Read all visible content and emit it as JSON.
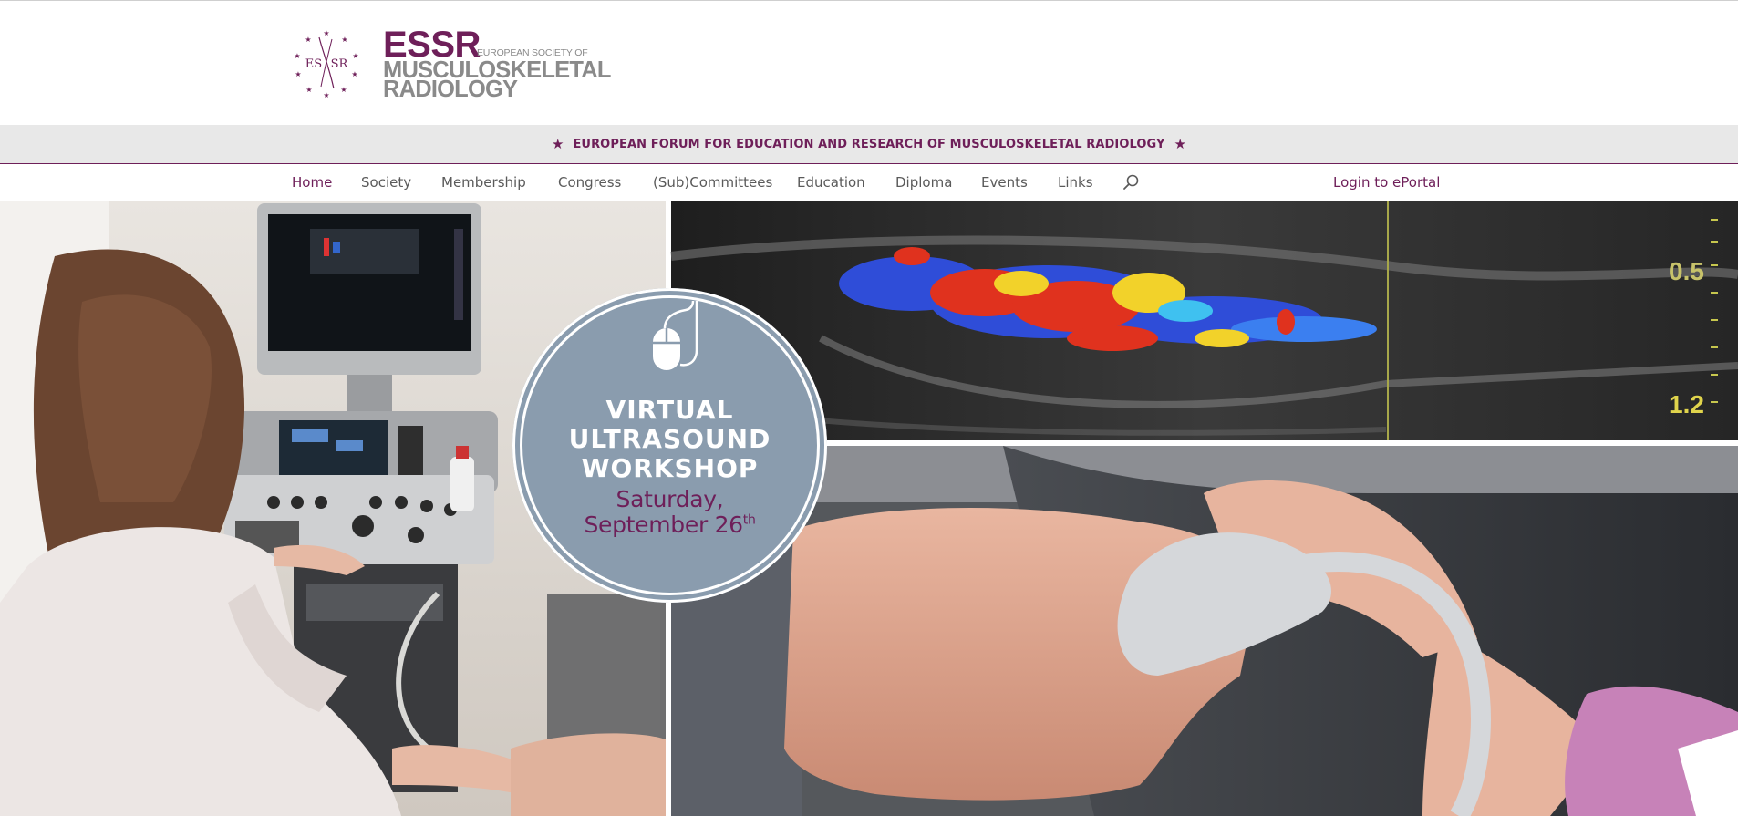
{
  "logo": {
    "emblem_text": "ESSR",
    "acronym": "ESSR",
    "org_line1": "EUROPEAN SOCIETY OF",
    "org_line2": "MUSCULOSKELETAL",
    "org_line3": "RADIOLOGY"
  },
  "tagline": {
    "star": "★",
    "text": "EUROPEAN FORUM FOR EDUCATION AND RESEARCH OF MUSCULOSKELETAL RADIOLOGY"
  },
  "nav": {
    "items": [
      {
        "label": "Home",
        "active": true
      },
      {
        "label": "Society",
        "active": false
      },
      {
        "label": "Membership",
        "active": false
      },
      {
        "label": "Congress",
        "active": false
      },
      {
        "label": "(Sub)Committees",
        "active": false
      },
      {
        "label": "Education",
        "active": false
      },
      {
        "label": "Diploma",
        "active": false
      },
      {
        "label": "Events",
        "active": false
      },
      {
        "label": "Links",
        "active": false
      }
    ],
    "search_icon": "search-icon",
    "login_label": "Login to ePortal"
  },
  "hero": {
    "badge": {
      "icon": "mouse-icon",
      "title_lines": [
        "VIRTUAL",
        "ULTRASOUND",
        "WORKSHOP"
      ],
      "date_line1": "Saturday,",
      "date_line2": "September 26",
      "date_suffix": "th"
    },
    "scan_readouts": [
      "0.5",
      "1.2"
    ]
  },
  "colors": {
    "brand_purple": "#6e1f59",
    "logo_grey": "#8a8a8a",
    "tagline_bg": "#e8e8e8",
    "badge_blue": "#8a9cae",
    "nav_text": "#5a5a5a"
  }
}
